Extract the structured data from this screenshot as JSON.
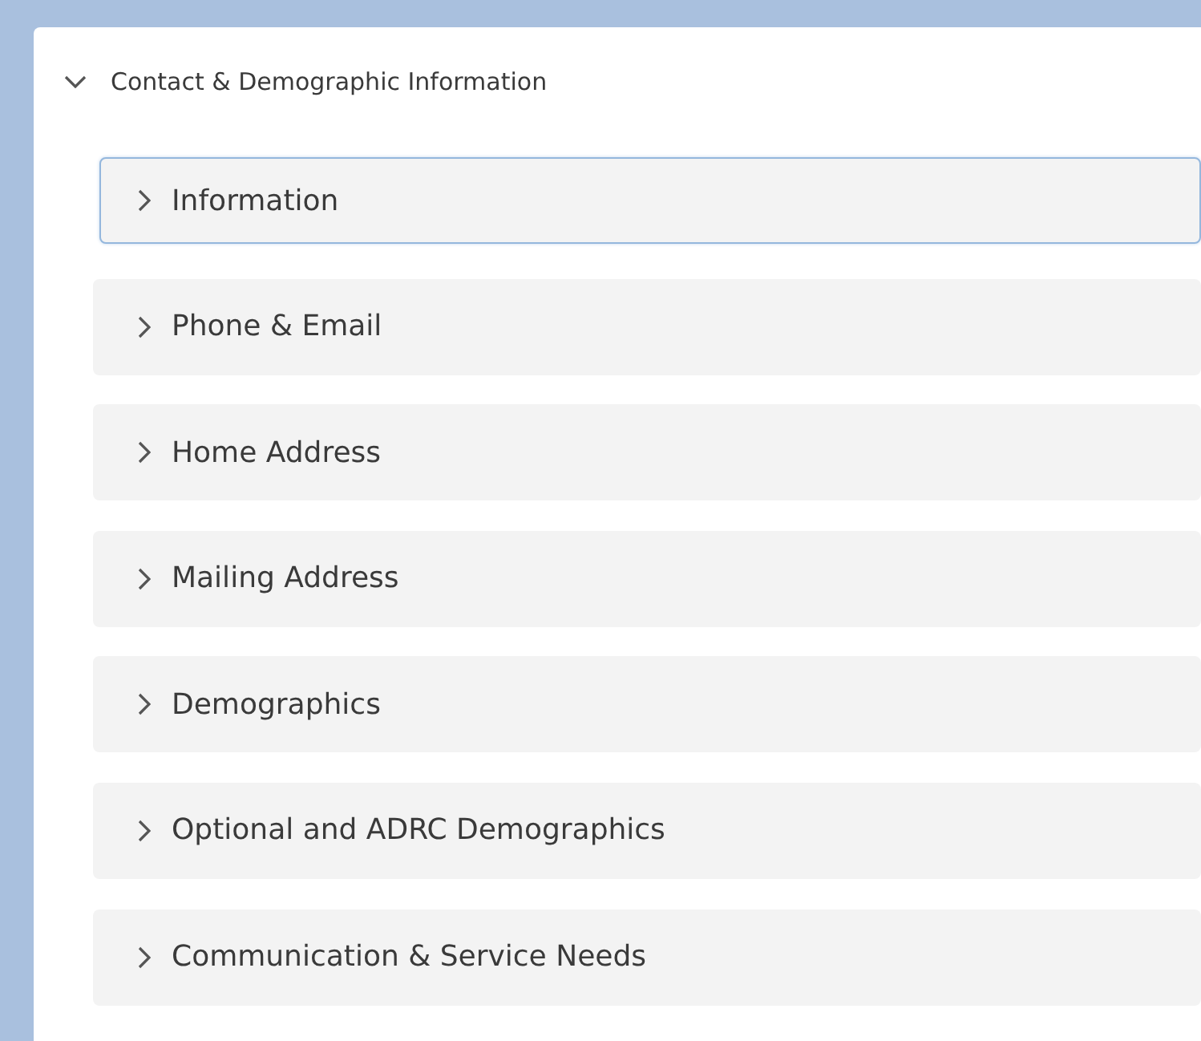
{
  "section": {
    "title": "Contact & Demographic Information",
    "expanded": true
  },
  "subsections": [
    {
      "label": "Information",
      "expanded": false,
      "focused": true
    },
    {
      "label": "Phone & Email",
      "expanded": false,
      "focused": false
    },
    {
      "label": "Home Address",
      "expanded": false,
      "focused": false
    },
    {
      "label": "Mailing Address",
      "expanded": false,
      "focused": false
    },
    {
      "label": "Demographics",
      "expanded": false,
      "focused": false
    },
    {
      "label": "Optional and ADRC Demographics",
      "expanded": false,
      "focused": false
    },
    {
      "label": "Communication & Service Needs",
      "expanded": false,
      "focused": false
    }
  ]
}
